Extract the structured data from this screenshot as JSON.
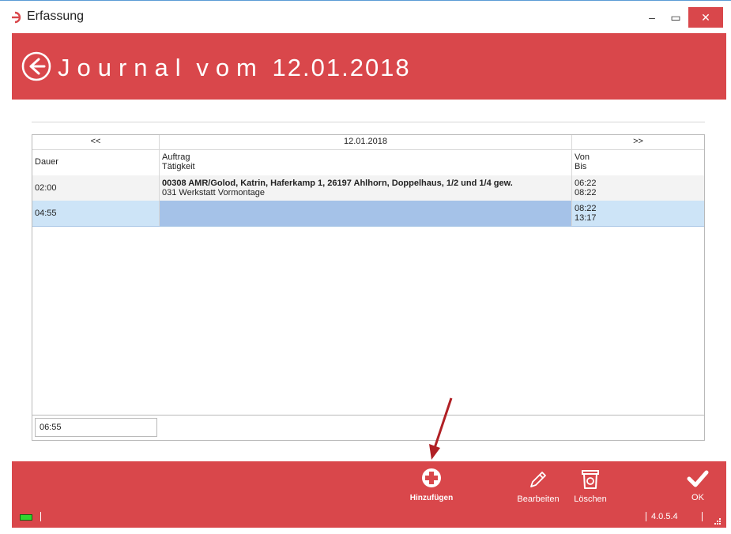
{
  "window": {
    "title": "Erfassung",
    "minimize_glyph": "‒",
    "maximize_glyph": "▭",
    "close_glyph": "✕"
  },
  "header": {
    "title_word": "Journal",
    "title_vom": "vom",
    "title_date": "12.01.2018",
    "back_icon": "arrow-left-circle-icon"
  },
  "grid": {
    "nav": {
      "prev": "<<",
      "date": "12.01.2018",
      "next": ">>"
    },
    "columns": {
      "dauer": "Dauer",
      "auftrag": "Auftrag",
      "taetigkeit": "Tätigkeit",
      "von": "Von",
      "bis": "Bis"
    },
    "rows": [
      {
        "dauer": "02:00",
        "auftrag": "00308 AMR/Golod, Katrin, Haferkamp 1, 26197 Ahlhorn, Doppelhaus, 1/2 und 1/4 gew.",
        "taetigkeit": "031 Werkstatt Vormontage",
        "von": "06:22",
        "bis": "08:22"
      },
      {
        "dauer": "04:55",
        "auftrag": "",
        "taetigkeit": "",
        "von": "08:22",
        "bis": "13:17"
      }
    ],
    "total": "06:55"
  },
  "toolbar": {
    "add_label": "Hinzufügen",
    "edit_label": "Bearbeiten",
    "delete_label": "Löschen",
    "ok_label": "OK"
  },
  "status": {
    "version": "4.0.5.4"
  },
  "colors": {
    "accent": "#d9474b",
    "selected_row": "#cde4f7",
    "selected_cell": "#a5c2e8",
    "annotation_arrow": "#b02025"
  }
}
